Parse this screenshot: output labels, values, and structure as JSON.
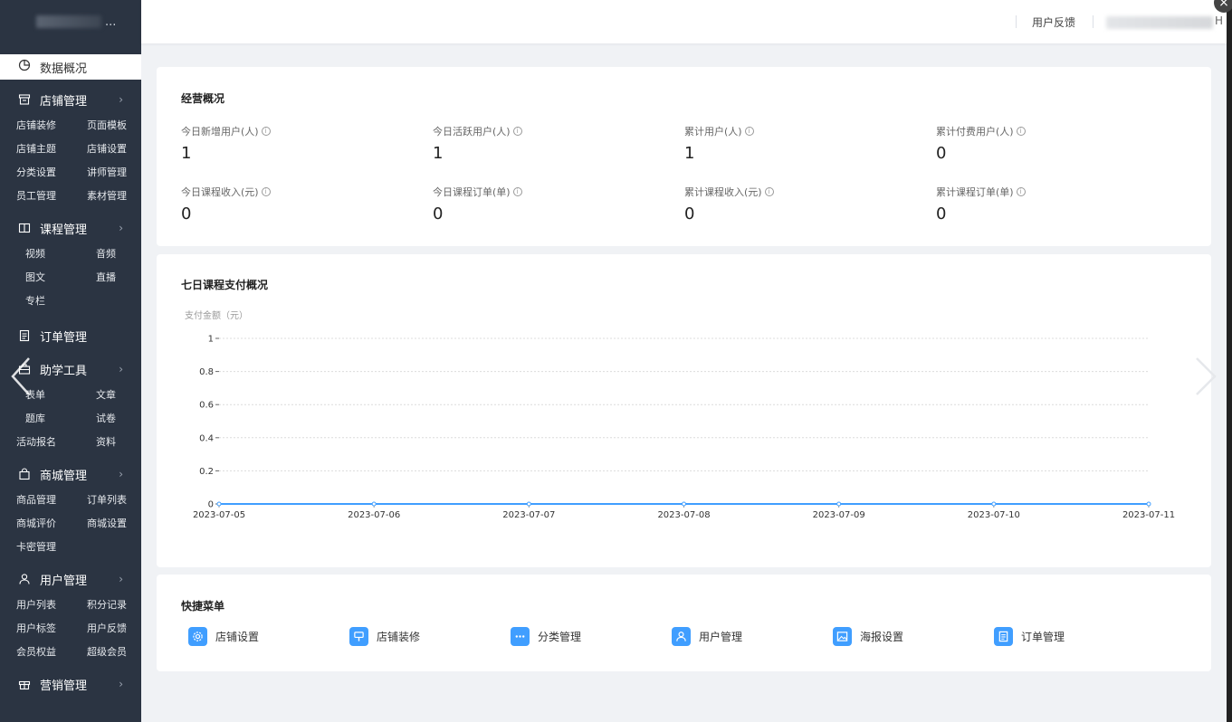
{
  "sidebar": {
    "brand_suffix": "...",
    "active_item": "数据概况",
    "sections": [
      {
        "title": "店铺管理",
        "icon": "store-icon",
        "items": [
          "店铺装修",
          "页面模板",
          "店铺主题",
          "店铺设置",
          "分类设置",
          "讲师管理",
          "员工管理",
          "素材管理"
        ]
      },
      {
        "title": "课程管理",
        "icon": "book-icon",
        "items": [
          "视频",
          "音频",
          "图文",
          "直播",
          "专栏"
        ]
      },
      {
        "title": "订单管理",
        "icon": "order-icon",
        "items": []
      },
      {
        "title": "助学工具",
        "icon": "toolbox-icon",
        "items": [
          "表单",
          "文章",
          "题库",
          "试卷",
          "活动报名",
          "资料"
        ]
      },
      {
        "title": "商城管理",
        "icon": "shopping-bag-icon",
        "items": [
          "商品管理",
          "订单列表",
          "商城评价",
          "商城设置",
          "卡密管理"
        ]
      },
      {
        "title": "用户管理",
        "icon": "user-icon",
        "items": [
          "用户列表",
          "积分记录",
          "用户标签",
          "用户反馈",
          "会员权益",
          "超级会员"
        ]
      },
      {
        "title": "营销管理",
        "icon": "gift-icon",
        "items": []
      }
    ]
  },
  "topbar": {
    "feedback": "用户反馈",
    "user_tail": "H"
  },
  "overview": {
    "title": "经营概况",
    "metrics": [
      {
        "label": "今日新增用户(人)",
        "value": "1"
      },
      {
        "label": "今日活跃用户(人)",
        "value": "1"
      },
      {
        "label": "累计用户(人)",
        "value": "1"
      },
      {
        "label": "累计付费用户(人)",
        "value": "0"
      },
      {
        "label": "今日课程收入(元)",
        "value": "0"
      },
      {
        "label": "今日课程订单(单)",
        "value": "0"
      },
      {
        "label": "累计课程收入(元)",
        "value": "0"
      },
      {
        "label": "累计课程订单(单)",
        "value": "0"
      }
    ]
  },
  "chart_card": {
    "title": "七日课程支付概况"
  },
  "chart_data": {
    "type": "line",
    "title": "七日课程支付概况",
    "ylabel": "支付金额（元）",
    "xlabel": "",
    "x": [
      "2023-07-05",
      "2023-07-06",
      "2023-07-07",
      "2023-07-08",
      "2023-07-09",
      "2023-07-10",
      "2023-07-11"
    ],
    "y": [
      0,
      0,
      0,
      0,
      0,
      0,
      0
    ],
    "ylim": [
      0,
      1
    ],
    "yticks": [
      "0",
      "0.2",
      "0.4",
      "0.6",
      "0.8",
      "1"
    ],
    "grid": true,
    "color": "#409eff"
  },
  "quick_menu": {
    "title": "快捷菜单",
    "items": [
      {
        "label": "店铺设置",
        "icon": "gear-icon"
      },
      {
        "label": "店铺装修",
        "icon": "decoration-icon"
      },
      {
        "label": "分类管理",
        "icon": "more-dots-icon"
      },
      {
        "label": "用户管理",
        "icon": "user-icon"
      },
      {
        "label": "海报设置",
        "icon": "image-icon"
      },
      {
        "label": "订单管理",
        "icon": "document-icon"
      }
    ]
  },
  "colors": {
    "sidebar_bg": "#2b3442",
    "accent": "#409eff",
    "page_bg": "#f0f2f5"
  }
}
